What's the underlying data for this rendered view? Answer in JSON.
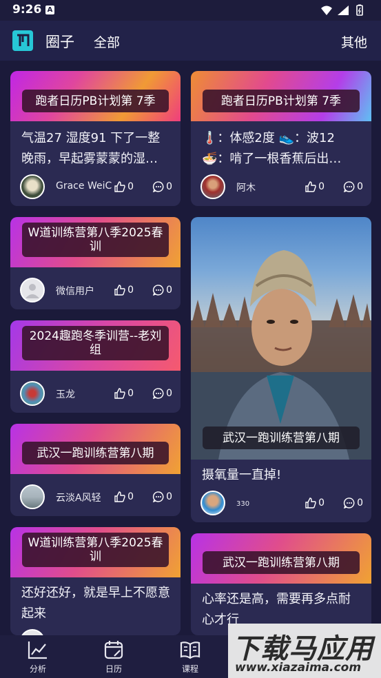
{
  "status": {
    "time": "9:26",
    "notification_icon": "A"
  },
  "header": {
    "title": "圈子",
    "filter": "全部",
    "other": "其他"
  },
  "cards": {
    "c1": {
      "tag": "跑者日历PB计划第 7季",
      "text": "气温27 湿度91 下了一整晚雨，早起雾蒙蒙的湿…",
      "user": "Grace WeiC",
      "likes": "0",
      "comments": "0"
    },
    "c2": {
      "tag": "跑者日历PB计划第 7季",
      "line1": "🌡️：体感2度 👟：波12",
      "line2": "🍜：啃了一根香蕉后出…",
      "user": "阿木",
      "likes": "0",
      "comments": "0"
    },
    "c3": {
      "tag": "W道训练营第八季2025春训",
      "user": "微信用户",
      "likes": "0",
      "comments": "0"
    },
    "c4": {
      "tag": "2024趣跑冬季训营--老刘组",
      "user": "玉龙",
      "likes": "0",
      "comments": "0"
    },
    "c5": {
      "tag": "武汉一跑训练营第八期",
      "text": "摄氧量一直掉!",
      "user": "330",
      "likes": "0",
      "comments": "0"
    },
    "c6": {
      "tag": "武汉一跑训练营第八期",
      "user": "云淡A风轻",
      "likes": "0",
      "comments": "0"
    },
    "c7": {
      "tag": "W道训练营第八季2025春训",
      "text": "还好还好，就是早上不愿意起来"
    },
    "c8": {
      "tag": "武汉一跑训练营第八期",
      "text": "心率还是高，需要再多点耐心才行"
    }
  },
  "nav": {
    "analysis": "分析",
    "calendar": "日历",
    "course": "课程"
  },
  "watermark": {
    "main": "下载马应用",
    "sub": "www.xiazaima.com"
  },
  "colors": {
    "background": "#1b1a3a",
    "card": "#2b2a52",
    "logo": "#27c7d6"
  }
}
